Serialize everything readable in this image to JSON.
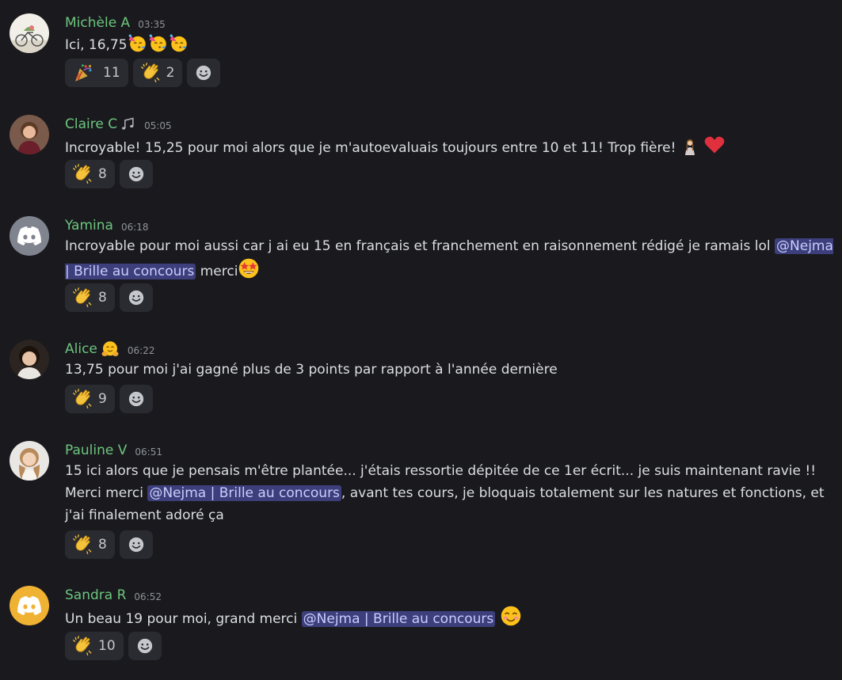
{
  "messages": [
    {
      "author": "Michèle A",
      "time": "03:35",
      "text": "Ici, 16,75",
      "avatar": "photo-bicycle",
      "reactions": [
        {
          "emoji": "party-popper-icon",
          "count": "11"
        },
        {
          "emoji": "clapping-hands-icon",
          "count": "2"
        }
      ]
    },
    {
      "author": "Claire C",
      "time": "05:05",
      "text": "Incroyable! 15,25 pour moi alors que je m'autoevaluais toujours entre 10 et 11! Trop fière!",
      "avatar": "photo-woman-brown-hair",
      "reactions": [
        {
          "emoji": "clapping-hands-icon",
          "count": "8"
        }
      ]
    },
    {
      "author": "Yamina",
      "time": "06:18",
      "text_before": "Incroyable pour moi aussi car j ai eu 15 en français et franchement en raisonnement rédigé je ramais lol",
      "mention": "@Nejma | Brille au concours",
      "text_after": "merci",
      "avatar": "discord-default-gray",
      "reactions": [
        {
          "emoji": "clapping-hands-icon",
          "count": "8"
        }
      ]
    },
    {
      "author": "Alice",
      "time": "06:22",
      "text": "13,75 pour moi j'ai gagné plus de 3 points par rapport à l'année dernière",
      "avatar": "photo-woman-dark-hair",
      "reactions": [
        {
          "emoji": "clapping-hands-icon",
          "count": "9"
        }
      ]
    },
    {
      "author": "Pauline V",
      "time": "06:51",
      "text_before": "15 ici alors que je pensais m'être plantée... j'étais ressortie dépitée de ce 1er écrit... je suis maintenant ravie !! Merci merci",
      "mention": "@Nejma | Brille au concours",
      "text_after": ", avant tes cours, je bloquais totalement sur les natures et fonctions, et j'ai finalement adoré ça",
      "avatar": "photo-woman-blonde",
      "reactions": [
        {
          "emoji": "clapping-hands-icon",
          "count": "8"
        }
      ]
    },
    {
      "author": "Sandra R",
      "time": "06:52",
      "text_before": "Un beau 19 pour moi, grand merci",
      "mention": "@Nejma | Brille au concours",
      "avatar": "discord-default-yellow",
      "reactions": [
        {
          "emoji": "clapping-hands-icon",
          "count": "10"
        }
      ]
    }
  ],
  "colors": {
    "background": "#1a1a1e",
    "author": "#6cc57e",
    "mention_bg": "#3c3f7c",
    "mention_text": "#c9cdfb",
    "reaction_bg": "#2a2b30"
  }
}
